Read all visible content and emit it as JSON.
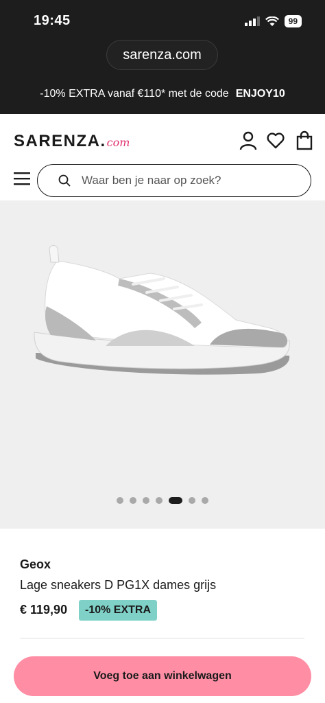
{
  "status_bar": {
    "time": "19:45",
    "battery": "99"
  },
  "browser": {
    "url": "sarenza.com"
  },
  "promo": {
    "text": "-10% EXTRA vanaf €110* met de code",
    "code": "ENJOY10"
  },
  "header": {
    "logo_main": "SARENZA.",
    "logo_suffix": "com",
    "search_placeholder": "Waar ben je naar op zoek?"
  },
  "gallery": {
    "image_count": 7,
    "active_index": 4
  },
  "product": {
    "brand": "Geox",
    "name": "Lage sneakers D PG1X dames grijs",
    "price": "€ 119,90",
    "discount_badge": "-10% EXTRA"
  },
  "cart_button_label": "Voeg toe aan winkelwagen",
  "colors": {
    "dark_bar": "#1d1d1d",
    "accent_pink": "#e0306f",
    "cart_button": "#ff8ea5",
    "badge": "#7fd1c8"
  }
}
